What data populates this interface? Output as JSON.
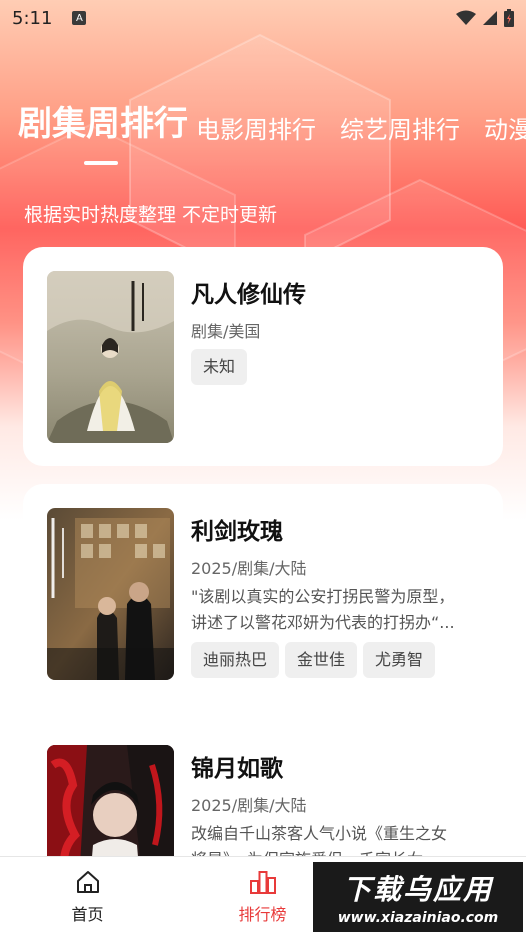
{
  "status_bar": {
    "time": "5:11",
    "notification_icon": "A",
    "icons": [
      "wifi-icon",
      "signal-icon",
      "battery-icon"
    ]
  },
  "tabs": [
    {
      "label": "剧集周排行",
      "active": true
    },
    {
      "label": "电影周排行",
      "active": false
    },
    {
      "label": "综艺周排行",
      "active": false
    },
    {
      "label": "动漫",
      "active": false
    }
  ],
  "subtitle": "根据实时热度整理 不定时更新",
  "items": [
    {
      "title": "凡人修仙传",
      "meta": "剧集/美国",
      "desc": [],
      "tags": [
        "未知"
      ]
    },
    {
      "title": "利剑玫瑰",
      "meta": "2025/剧集/大陆",
      "desc": [
        "\"该剧以真实的公安打拐民警为原型，",
        "讲述了以警花邓妍为代表的打拐办“..."
      ],
      "tags": [
        "迪丽热巴",
        "金世佳",
        "尤勇智"
      ]
    },
    {
      "title": "锦月如歌",
      "meta": "2025/剧集/大陆",
      "desc": [
        "改编自千山茶客人气小说《重生之女",
        "将星》，为保家族爱侣，千家长女..."
      ],
      "tags": []
    }
  ],
  "bottom_nav": [
    {
      "label": "首页",
      "icon": "home-icon",
      "active": false
    },
    {
      "label": "排行榜",
      "icon": "ranking-icon",
      "active": true
    }
  ],
  "watermark": {
    "line1": "下载乌应用",
    "line2": "www.xiazainiao.com"
  },
  "colors": {
    "accent": "#e83a3a",
    "header_gradient_top": "#ffcdb4",
    "header_gradient_mid": "#ff5a55"
  }
}
